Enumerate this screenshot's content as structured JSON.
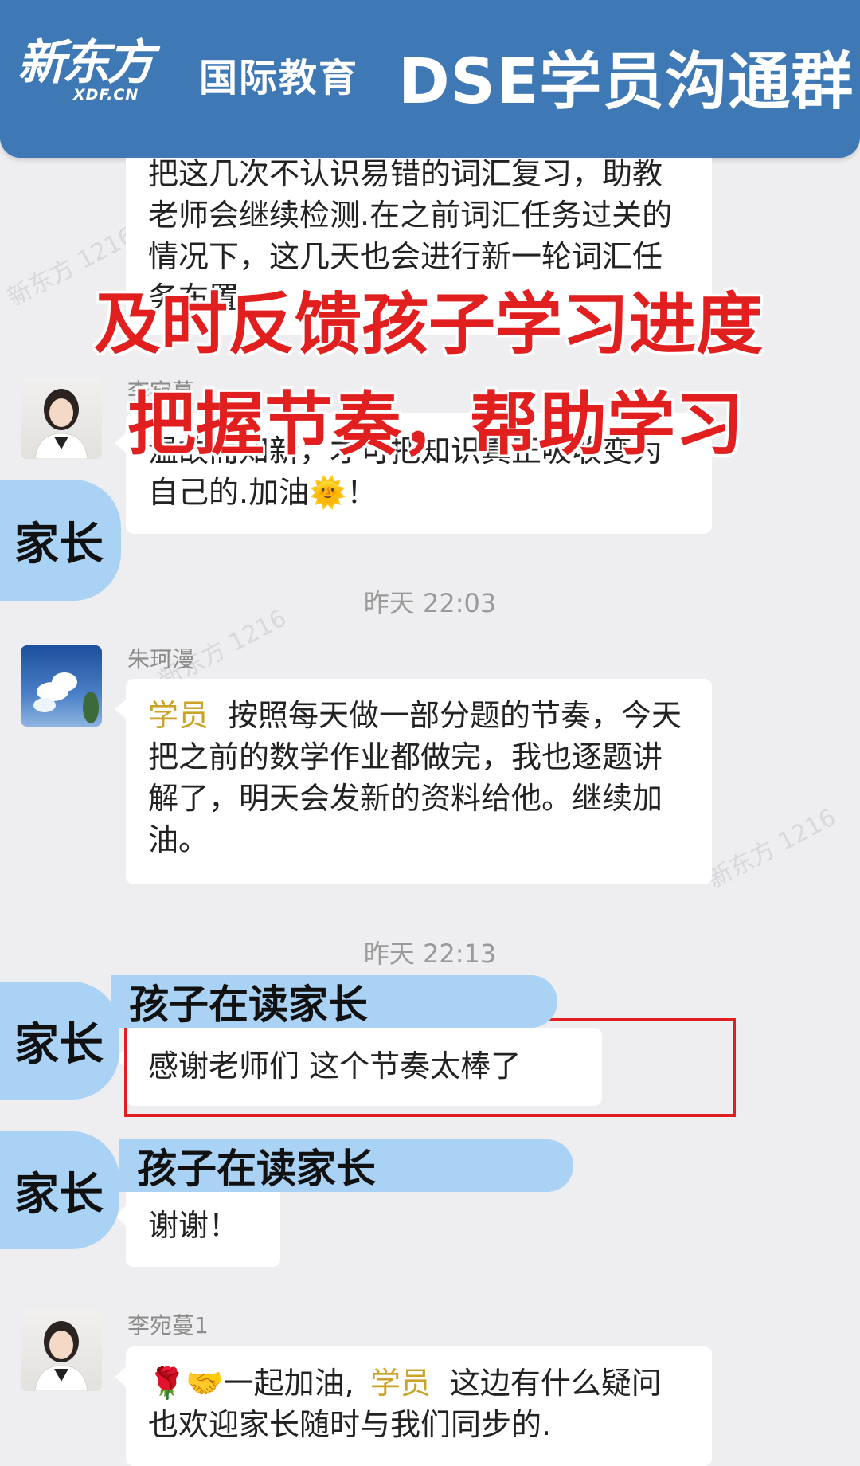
{
  "header": {
    "logo_cn": "新东方",
    "logo_en": "XDF.CN",
    "subtitle": "国际教育",
    "title": "DSE学员沟通群"
  },
  "watermark": "新东方 1216",
  "overlay": {
    "caption_line1": "及时反馈孩子学习进度",
    "caption_line2": "把握节奏，帮助学习",
    "role_parent": "家长",
    "parent_tag": "孩子在读家长"
  },
  "messages": {
    "m1": {
      "text": "把这几次不认识易错的词汇复习，助教老师会继续检测.在之前词汇任务过关的情况下，这几天也会进行新一轮词汇任务布置."
    },
    "m2": {
      "sender": "李宛蔓",
      "text": "温故而知新，才可把知识真正吸收变为自己的.加油🌞！"
    },
    "time1": "昨天 22:03",
    "m3": {
      "sender": "朱珂漫",
      "tag": "学员",
      "text": "按照每天做一部分题的节奏，今天把之前的数学作业都做完，我也逐题讲解了，明天会发新的资料给他。继续加油。"
    },
    "time2": "昨天 22:13",
    "m4": {
      "text": "感谢老师们 这个节奏太棒了"
    },
    "m5": {
      "text": "谢谢！"
    },
    "m6": {
      "sender": "李宛蔓1",
      "prefix": "🌹🤝一起加油,",
      "tag": "学员",
      "text": "这边有什么疑问也欢迎家长随时与我们同步的."
    }
  }
}
